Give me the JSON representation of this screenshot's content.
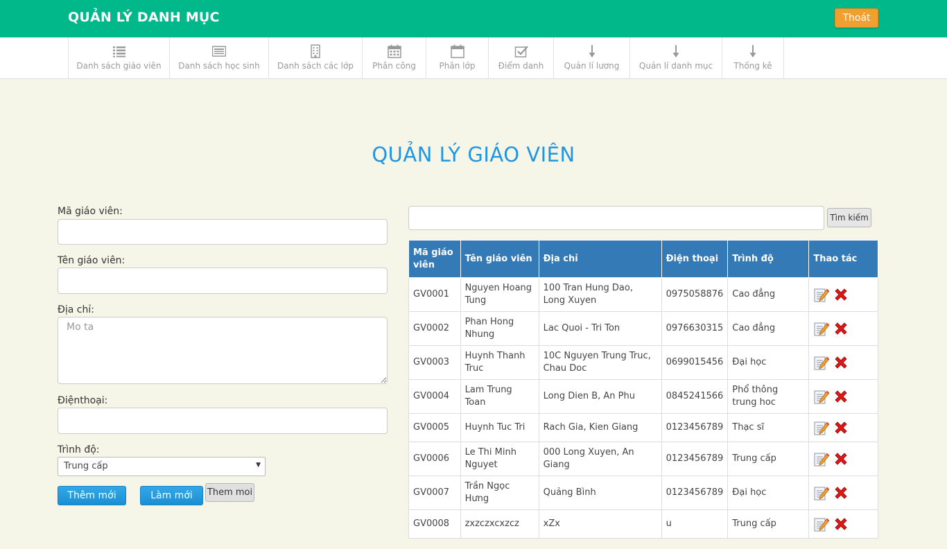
{
  "header": {
    "brand": "QUẢN LÝ DANH MỤC",
    "logout_label": "Thoát"
  },
  "nav": [
    {
      "label": "Danh sách giáo viên",
      "icon": "list-icon"
    },
    {
      "label": "Danh sách học sinh",
      "icon": "id-card-icon"
    },
    {
      "label": "Danh sách các lớp",
      "icon": "building-icon"
    },
    {
      "label": "Phân công",
      "icon": "calendar-icon"
    },
    {
      "label": "Phân lớp",
      "icon": "calendar-blank-icon"
    },
    {
      "label": "Điểm danh",
      "icon": "check-square-icon"
    },
    {
      "label": "Quản lí lương",
      "icon": "arrow-down-icon"
    },
    {
      "label": "Quản lí danh mục",
      "icon": "arrow-down-icon"
    },
    {
      "label": "Thống kê",
      "icon": "arrow-down-icon"
    }
  ],
  "page_title": "QUẢN LÝ GIÁO VIÊN",
  "form": {
    "id_label": "Mã giáo viên:",
    "id_value": "",
    "name_label": "Tên giáo viên:",
    "name_value": "",
    "address_label": "Địa chỉ:",
    "address_placeholder": "Mo ta",
    "phone_label": "Điệnthoại:",
    "phone_value": "",
    "level_label": "Trình độ:",
    "level_selected": "Trung cấp",
    "add_button": "Thêm mới",
    "reset_button": "Làm mới",
    "extra_button": "Them moi"
  },
  "search": {
    "value": "",
    "button_label": "Tìm kiếm"
  },
  "table": {
    "columns": [
      "Mã giáo viên",
      "Tên giáo viên",
      "Địa chỉ",
      "Điện thoại",
      "Trình độ",
      "Thao tác"
    ],
    "rows": [
      [
        "GV0001",
        "Nguyen Hoang Tung",
        "100 Tran Hung Dao, Long Xuyen",
        "0975058876",
        "Cao đẳng"
      ],
      [
        "GV0002",
        "Phan Hong Nhung",
        "Lac Quoi - Tri Ton",
        "0976630315",
        "Cao đẳng"
      ],
      [
        "GV0003",
        "Huynh Thanh Truc",
        "10C Nguyen Trung Truc, Chau Doc",
        "0699015456",
        "Đại học"
      ],
      [
        "GV0004",
        "Lam Trung Toan",
        "Long Dien B, An Phu",
        "0845241566",
        "Phổ thông trung hoc"
      ],
      [
        "GV0005",
        "Huynh Tuc Tri",
        "Rach Gia, Kien Giang",
        "0123456789",
        "Thạc sĩ"
      ],
      [
        "GV0006",
        "Le Thi Minh Nguyet",
        "000 Long Xuyen, An Giang",
        "0123456789",
        "Trung cấp"
      ],
      [
        "GV0007",
        "Trần Ngọc Hưng",
        "Quảng Bình",
        "0123456789",
        "Đại học"
      ],
      [
        "GV0008",
        "zxzczxcxzcz",
        "xZx",
        "u",
        "Trung cấp"
      ]
    ],
    "row_actions": [
      "edit-icon",
      "delete-icon"
    ]
  },
  "colors": {
    "header_bg": "#00b88a",
    "logout_bg": "#f0a030",
    "title": "#2196e0",
    "table_header": "#337ab7",
    "page_bg": "#f5f5e8"
  }
}
